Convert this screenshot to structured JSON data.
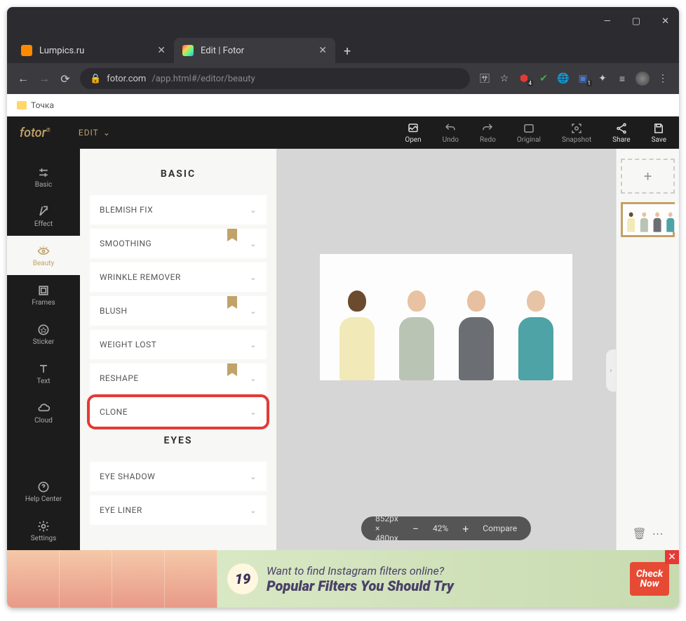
{
  "tabs": [
    {
      "title": "Lumpics.ru"
    },
    {
      "title": "Edit | Fotor"
    }
  ],
  "url": {
    "host": "fotor.com",
    "path": "/app.html#/editor/beauty"
  },
  "bookmark": "Точка",
  "app": {
    "logo": "fotor",
    "mode": "EDIT",
    "actions": {
      "open": "Open",
      "undo": "Undo",
      "redo": "Redo",
      "original": "Original",
      "snapshot": "Snapshot",
      "share": "Share",
      "save": "Save"
    },
    "leftnav": [
      {
        "key": "basic",
        "label": "Basic"
      },
      {
        "key": "effect",
        "label": "Effect"
      },
      {
        "key": "beauty",
        "label": "Beauty"
      },
      {
        "key": "frames",
        "label": "Frames"
      },
      {
        "key": "sticker",
        "label": "Sticker"
      },
      {
        "key": "text",
        "label": "Text"
      },
      {
        "key": "cloud",
        "label": "Cloud"
      },
      {
        "key": "help",
        "label": "Help Center"
      },
      {
        "key": "settings",
        "label": "Settings"
      }
    ],
    "panel": {
      "section1": "BASIC",
      "items1": [
        {
          "label": "BLEMISH FIX",
          "ribbon": false
        },
        {
          "label": "SMOOTHING",
          "ribbon": true
        },
        {
          "label": "WRINKLE REMOVER",
          "ribbon": false
        },
        {
          "label": "BLUSH",
          "ribbon": true
        },
        {
          "label": "WEIGHT LOST",
          "ribbon": false
        },
        {
          "label": "RESHAPE",
          "ribbon": true
        },
        {
          "label": "CLONE",
          "ribbon": false,
          "highlight": true
        }
      ],
      "section2": "EYES",
      "items2": [
        {
          "label": "EYE SHADOW"
        },
        {
          "label": "EYE LINER"
        }
      ]
    },
    "zoom": {
      "dims": "852px × 480px",
      "pct": "42%",
      "compare": "Compare"
    }
  },
  "ad": {
    "num": "19",
    "line1": "Want to find Instagram filters online?",
    "line2": "Popular Filters You Should Try",
    "cta1": "Check",
    "cta2": "Now"
  }
}
